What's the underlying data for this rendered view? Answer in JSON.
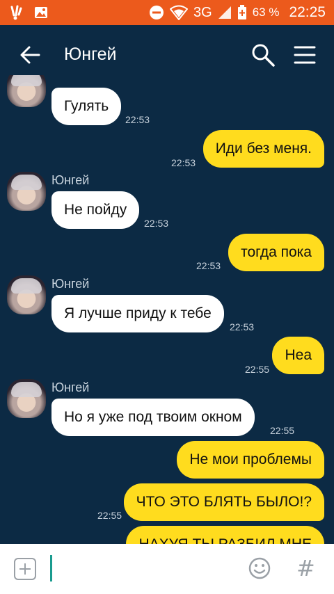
{
  "status_bar": {
    "battery_percent": "63 %",
    "network": "3G",
    "time": "22:25"
  },
  "header": {
    "title": "Юнгей",
    "back_icon": "arrow-left-icon",
    "search_icon": "search-icon",
    "menu_icon": "hamburger-menu-icon"
  },
  "messages": [
    {
      "direction": "in",
      "text": "Гулять",
      "time": "22:53"
    },
    {
      "direction": "out",
      "text": "Иди без меня.",
      "time": "22:53"
    },
    {
      "direction": "in",
      "sender": "Юнгей",
      "text": "Не пойду",
      "time": "22:53"
    },
    {
      "direction": "out",
      "text": "тогда пока",
      "time": "22:53"
    },
    {
      "direction": "in",
      "sender": "Юнгей",
      "text": "Я лучше приду к тебе",
      "time": "22:53"
    },
    {
      "direction": "out",
      "text": "Неа",
      "time": "22:55"
    },
    {
      "direction": "in",
      "sender": "Юнгей",
      "text": "Но я уже под твоим окном",
      "time": "22:55"
    },
    {
      "direction": "out",
      "text": "Не мои проблемы"
    },
    {
      "direction": "out",
      "text": "ЧТО ЭТО БЛЯТЬ БЫЛО!?",
      "time": "22:55"
    },
    {
      "direction": "out",
      "text": "НАХУЯ ТЫ РАЗБИЛ МНЕ"
    }
  ],
  "composer": {
    "input_value": "",
    "add_icon": "plus-square-icon",
    "emoji_icon": "smiley-icon",
    "hash_label": "#"
  },
  "colors": {
    "status_bar": "#ec5a1c",
    "background": "#0c2a44",
    "incoming_bubble": "#ffffff",
    "outgoing_bubble": "#ffdc1e",
    "cursor": "#1a9b8f"
  }
}
